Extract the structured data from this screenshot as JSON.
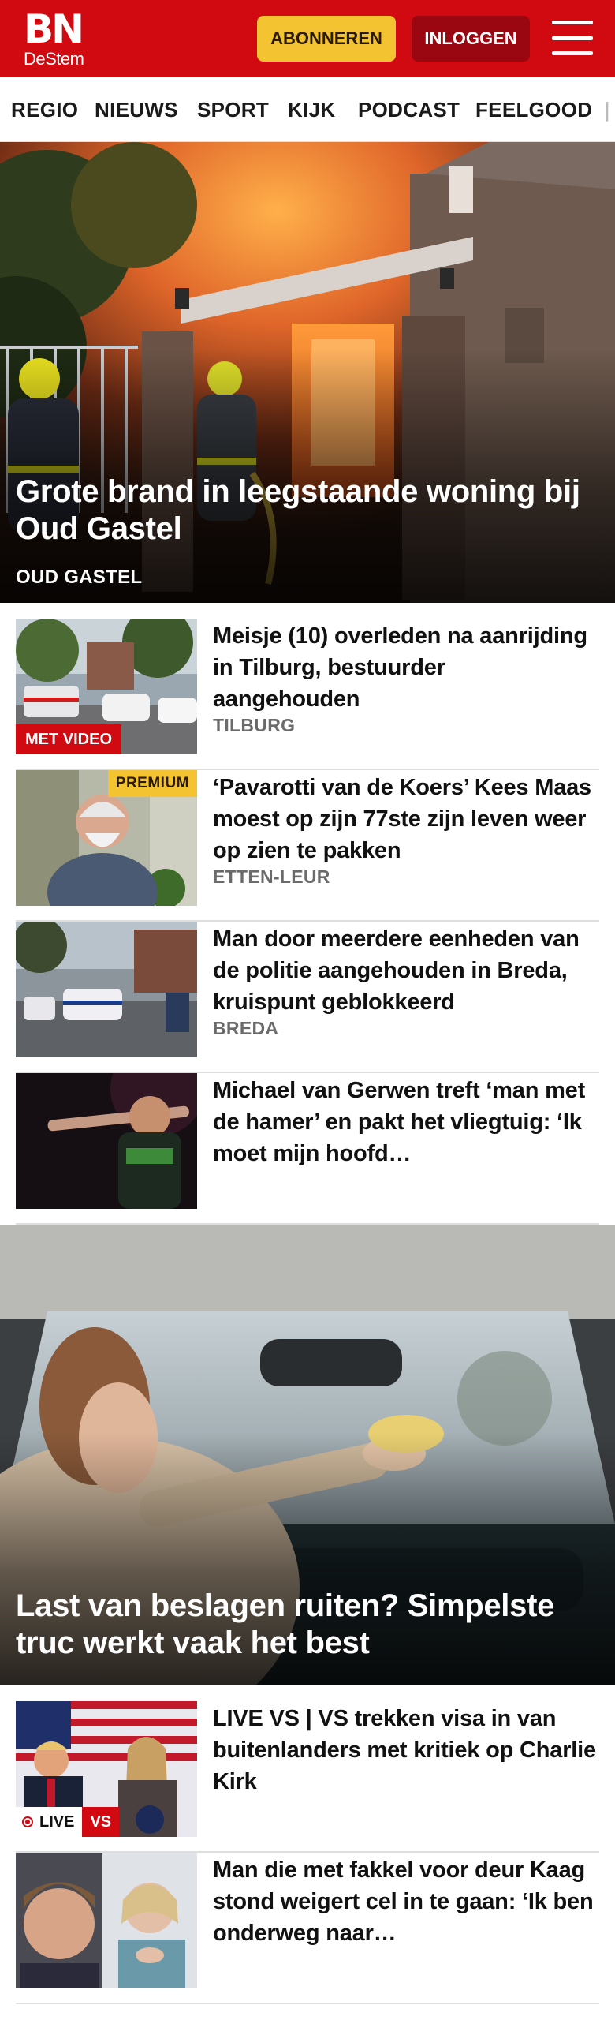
{
  "header": {
    "logo": {
      "main": "BN",
      "sub": "DeStem"
    },
    "subscribe_label": "ABONNEREN",
    "login_label": "INLOGGEN",
    "menu_icon": "hamburger-menu-icon",
    "brand_color": "#d10a11",
    "subscribe_color": "#f3c332",
    "login_color": "#9a0710"
  },
  "nav": {
    "items": [
      "REGIO",
      "NIEUWS",
      "SPORT",
      "KIJK",
      "PODCAST",
      "FEELGOOD"
    ]
  },
  "hero": {
    "headline": "Grote brand in leegstaande woning bij Oud Gastel",
    "place": "OUD GASTEL",
    "image": "house-fire-firefighters-photo"
  },
  "articles": [
    {
      "title": "Meisje (10) overleden na aanrijding in Tilburg, bestuurder aangehouden",
      "place": "TILBURG",
      "badge": "MET VIDEO",
      "image": "accident-scene-emergency-vehicles-photo"
    },
    {
      "title": "‘Pavarotti van de Koers’ Kees Maas moest op zijn 77ste zijn leven weer op zien te pakken",
      "place": "ETTEN-LEUR",
      "badge": "PREMIUM",
      "image": "elderly-man-portrait-photo"
    },
    {
      "title": "Man door meerdere eenheden van de politie aangehouden in Breda, kruispunt geblokkeerd",
      "place": "BREDA",
      "badge": "",
      "image": "police-cars-intersection-photo"
    },
    {
      "title": "Michael van Gerwen treft ‘man met de hamer’ en pakt het vliegtuig: ‘Ik moet mijn hoofd…",
      "place": "",
      "badge": "",
      "image": "darts-player-photo"
    }
  ],
  "feature": {
    "headline": "Last van beslagen ruiten? Simpelste truc werkt vaak het best",
    "image": "woman-wiping-car-windshield-photo"
  },
  "articles2": [
    {
      "title": "LIVE VS | VS trekken visa in van buitenlanders met kritiek op Charlie Kirk",
      "badge_live": "LIVE",
      "badge_tag": "VS",
      "image": "press-conference-flags-photo"
    },
    {
      "title": "Man die met fakkel voor deur Kaag stond weigert cel in te gaan: ‘Ik ben onderweg naar…",
      "image": "two-portraits-photo"
    }
  ]
}
